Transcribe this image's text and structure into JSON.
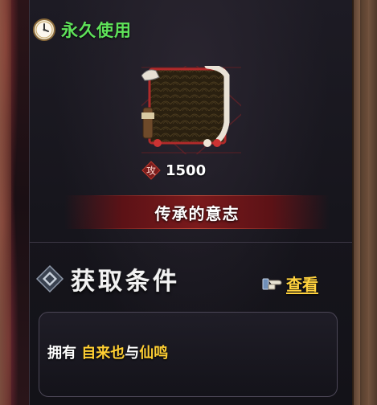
{
  "timer": {
    "label": "永久使用",
    "icon": "clock-icon"
  },
  "item": {
    "name": "传承的意志",
    "attack": {
      "icon": "attack-icon",
      "icon_char": "攻",
      "value": "1500"
    }
  },
  "acquire": {
    "title": "获取条件",
    "view_label": "查看",
    "condition": {
      "prefix": "拥有 ",
      "name1": "自来也",
      "joiner": "与",
      "name2": "仙鸣"
    }
  },
  "colors": {
    "timer_green": "#5fe35a",
    "highlight_gold": "#ffcf33",
    "name_bar_red": "#7a1a1c"
  }
}
